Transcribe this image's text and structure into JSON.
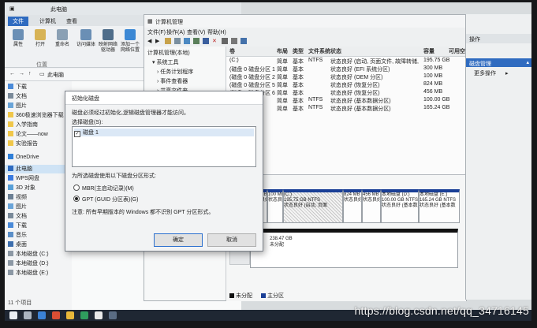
{
  "explorer": {
    "title": "此电脑",
    "tabs": [
      "文件",
      "计算机",
      "查看"
    ],
    "ribbon": [
      {
        "label": "属性"
      },
      {
        "label": "打开"
      },
      {
        "label": "重命名"
      },
      {
        "label": "访问媒体"
      },
      {
        "label": "映射网络驱动器"
      },
      {
        "label": "添加一个网络位置"
      }
    ],
    "ribbon_group": "位置",
    "address": "此电脑",
    "sidebar": [
      {
        "label": "下载"
      },
      {
        "label": "文档"
      },
      {
        "label": "图片"
      },
      {
        "label": "360极速浏览器下载"
      },
      {
        "label": "入学指南"
      },
      {
        "label": "论文——now"
      },
      {
        "label": "实验报告"
      },
      {
        "label": "OneDrive"
      },
      {
        "label": "此电脑"
      },
      {
        "label": "WPS网盘"
      },
      {
        "label": "3D 对象"
      },
      {
        "label": "视频"
      },
      {
        "label": "图片"
      },
      {
        "label": "文档"
      },
      {
        "label": "下载"
      },
      {
        "label": "音乐"
      },
      {
        "label": "桌面"
      },
      {
        "label": "本地磁盘 (C:)"
      },
      {
        "label": "本地磁盘 (D:)"
      },
      {
        "label": "本地磁盘 (E:)"
      }
    ],
    "status": "11 个项目"
  },
  "disk_mgmt": {
    "title": "计算机管理",
    "menu": [
      "文件(F)",
      "操作(A)",
      "查看(V)",
      "帮助(H)"
    ],
    "tree": [
      {
        "label": "计算机管理(本地)"
      },
      {
        "label": "系统工具"
      },
      {
        "label": "任务计划程序"
      },
      {
        "label": "事件查看器"
      },
      {
        "label": "共享文件夹"
      }
    ],
    "list_headers": [
      "卷",
      "布局",
      "类型",
      "文件系统",
      "状态",
      "容量",
      "可用空间"
    ],
    "rows": [
      {
        "vol": "(C:)",
        "layout": "简单",
        "type": "基本",
        "fs": "NTFS",
        "status": "状态良好 (启动, 页面文件, 故障转储, 基本数据分区)",
        "cap": "195.75 GB"
      },
      {
        "vol": "(磁盘 0 磁盘分区 1)",
        "layout": "简单",
        "type": "基本",
        "fs": "",
        "status": "状态良好 (EFI 系统分区)",
        "cap": "300 MB"
      },
      {
        "vol": "(磁盘 0 磁盘分区 2)",
        "layout": "简单",
        "type": "基本",
        "fs": "",
        "status": "状态良好 (OEM 分区)",
        "cap": "100 MB"
      },
      {
        "vol": "(磁盘 0 磁盘分区 5)",
        "layout": "简单",
        "type": "基本",
        "fs": "",
        "status": "状态良好 (恢复分区)",
        "cap": "824 MB"
      },
      {
        "vol": "(磁盘 0 磁盘分区 6)",
        "layout": "简单",
        "type": "基本",
        "fs": "",
        "status": "状态良好 (恢复分区)",
        "cap": "456 MB"
      },
      {
        "vol": "本地磁盘 (D:)",
        "layout": "简单",
        "type": "基本",
        "fs": "NTFS",
        "status": "状态良好 (基本数据分区)",
        "cap": "100.00 GB"
      },
      {
        "vol": "本地磁盘 (E:)",
        "layout": "简单",
        "type": "基本",
        "fs": "NTFS",
        "status": "状态良好 (基本数据分区)",
        "cap": "165.24 GB"
      }
    ],
    "partitions": [
      {
        "l1": "300 MB",
        "l2": "状态良好"
      },
      {
        "l1": "100 MB",
        "l2": "状态良好"
      },
      {
        "l1": "(C:)",
        "l2": "195.75 GB NTFS",
        "l3": "状态良好 (启动, 页面"
      },
      {
        "l1": "824 MB",
        "l2": "状态良好"
      },
      {
        "l1": "456 MB",
        "l2": "状态良好"
      },
      {
        "l1": "本地磁盘 (D:)",
        "l2": "100.00 GB NTFS",
        "l3": "状态良好 (基本数"
      },
      {
        "l1": "本地磁盘 (E:)",
        "l2": "165.24 GB NTFS",
        "l3": "状态良好 (基本数"
      }
    ],
    "unalloc": {
      "size": "238.47 GB",
      "label": "未分配"
    },
    "legend": [
      "未分配",
      "主分区"
    ]
  },
  "actions": {
    "header": "操作",
    "group": "磁盘管理",
    "more": "更多操作"
  },
  "dialog": {
    "title": "初始化磁盘",
    "intro": "磁盘必须经过初始化,逻辑磁盘管理器才能访问。",
    "select_label": "选择磁盘(S):",
    "disk_item": "磁盘 1",
    "style_label": "为所选磁盘使用以下磁盘分区形式:",
    "options": [
      {
        "label": "MBR(主启动记录)(M)",
        "selected": false
      },
      {
        "label": "GPT (GUID 分区表)(G)",
        "selected": true
      }
    ],
    "note": "注意: 所有早期版本的 Windows 都不识别 GPT 分区形式。",
    "ok": "确定",
    "cancel": "取消"
  },
  "watermark": "https://blog.csdn.net/qq_34716145"
}
